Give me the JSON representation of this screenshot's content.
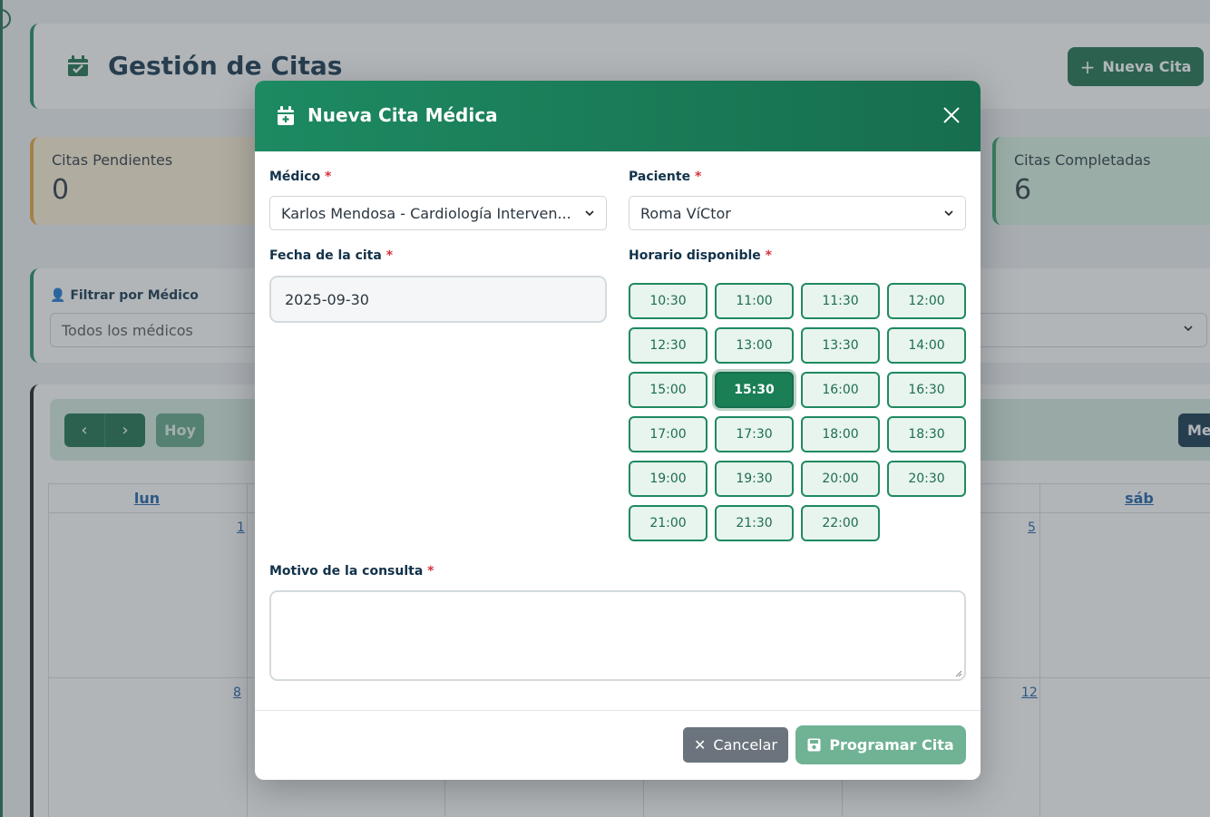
{
  "page": {
    "title": "Gestión de Citas",
    "new_button_label": "Nueva Cita"
  },
  "stats": {
    "pending_label": "Citas Pendientes",
    "pending_value": "0",
    "completed_label": "Citas Completadas",
    "completed_value": "6"
  },
  "filter": {
    "label": "Filtrar por Médico",
    "selected": "Todos los médicos"
  },
  "calendar": {
    "today_label": "Hoy",
    "view_label": "Mes",
    "day_headers": [
      "lun",
      "sáb"
    ],
    "day_numbers": [
      "1",
      "5",
      "8",
      "12"
    ]
  },
  "modal": {
    "title": "Nueva Cita Médica",
    "doctor_label": "Médico",
    "doctor_value": "Karlos Mendosa - Cardiología Interven...",
    "patient_label": "Paciente",
    "patient_value": "Roma VíCtor",
    "date_label": "Fecha de la cita",
    "date_value": "2025-09-30",
    "slots_label": "Horario disponible",
    "slots": [
      "10:30",
      "11:00",
      "11:30",
      "12:00",
      "12:30",
      "13:00",
      "13:30",
      "14:00",
      "15:00",
      "15:30",
      "16:00",
      "16:30",
      "17:00",
      "17:30",
      "18:00",
      "18:30",
      "19:00",
      "19:30",
      "20:00",
      "20:30",
      "21:00",
      "21:30",
      "22:00"
    ],
    "selected_slot": "15:30",
    "reason_label": "Motivo de la consulta",
    "reason_value": "",
    "required_mark": "*",
    "cancel_label": "Cancelar",
    "submit_label": "Programar Cita"
  },
  "colors": {
    "primary": "#1a6e4d",
    "accent": "#1d8a62",
    "required": "#d6323c",
    "navy": "#12324a"
  }
}
